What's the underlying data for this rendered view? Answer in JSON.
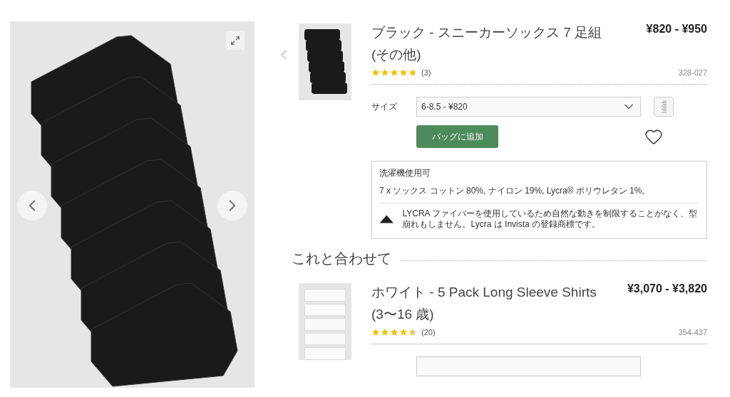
{
  "product": {
    "title": "ブラック - スニーカーソックス 7 足組 (その他)",
    "price": "¥820 - ¥950",
    "stars": 5,
    "review_count": "(3)",
    "code": "328-027",
    "size": {
      "label": "サイズ",
      "value": "6-8.5 - ¥820"
    },
    "add_button": "バッグに追加",
    "info": {
      "care": "洗濯機使用可",
      "composition": "7 x ソックス コットン 80%, ナイロン 19%, Lycra® ポリウレタン 1%。",
      "lycra_note": "LYCRA ファイバーを使用しているため自然な動きを制限することがなく、型崩れもしません。Lycra は Invista の登録商標です。"
    }
  },
  "related": {
    "heading": "これと合わせて",
    "items": [
      {
        "title": "ホワイト - 5 Pack Long Sleeve Shirts (3〜16 歳)",
        "price": "¥3,070 - ¥3,820",
        "stars": 4.5,
        "review_count": "(20)",
        "code": "354-437"
      }
    ]
  }
}
